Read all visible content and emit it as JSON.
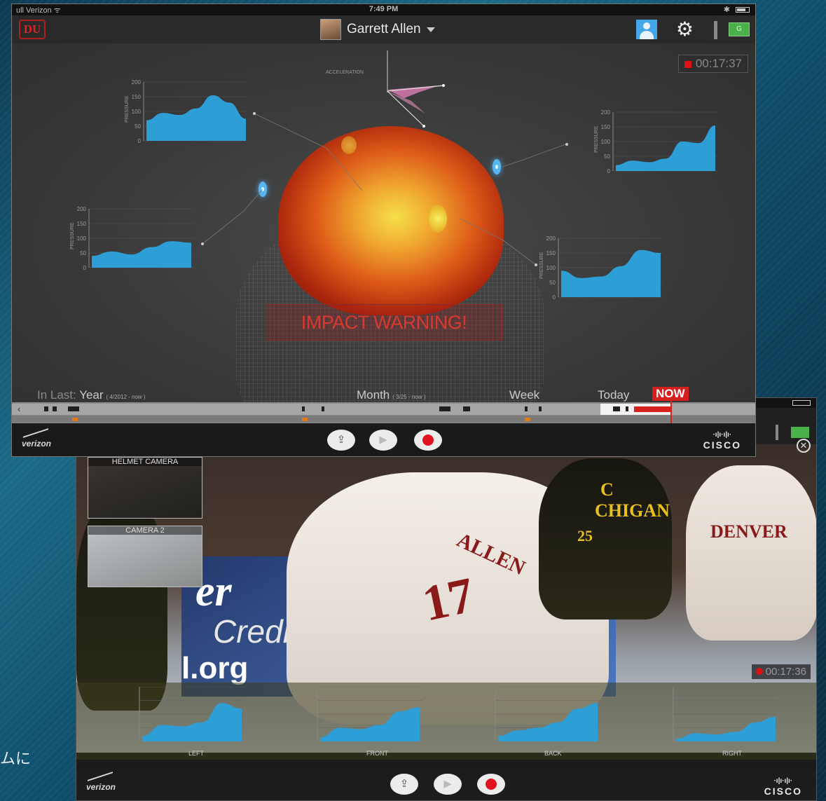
{
  "caption": "ムに",
  "front": {
    "statusbar": {
      "carrier": "ull Verizon ᯤ",
      "time": "7:49 PM",
      "bluetooth": "✱"
    },
    "topbar": {
      "logo": "DU",
      "user_name": "Garrett Allen",
      "green_badge": "G"
    },
    "timer": "00:17:37",
    "accel_label": "ACCELERATION",
    "impact_warning": "IMPACT WARNING!",
    "charts": [
      {
        "id": "top-left",
        "ylabel": "PRESSURE",
        "ticks": [
          "200",
          "150",
          "100",
          "50",
          "0"
        ],
        "values": [
          70,
          95,
          88,
          110,
          155,
          130,
          75
        ]
      },
      {
        "id": "top-right",
        "ylabel": "PRESSURE",
        "ticks": [
          "200",
          "150",
          "100",
          "50",
          "0"
        ],
        "values": [
          20,
          35,
          30,
          42,
          100,
          95,
          155
        ]
      },
      {
        "id": "mid-left",
        "ylabel": "PRESSURE",
        "ticks": [
          "200",
          "150",
          "100",
          "50",
          "0"
        ],
        "values": [
          40,
          55,
          45,
          70,
          90,
          85
        ]
      },
      {
        "id": "mid-right",
        "ylabel": "PRESSURE",
        "ticks": [
          "200",
          "150",
          "100",
          "50",
          "0"
        ],
        "values": [
          90,
          65,
          70,
          105,
          160,
          150
        ]
      }
    ],
    "range": {
      "in_last": "In Last:",
      "year": "Year",
      "year_sub": "( 4/2012 - now )",
      "month": "Month",
      "month_sub": "( 3/25 - now )",
      "week": "Week",
      "today": "Today",
      "now": "NOW"
    },
    "brand_left": "verizon",
    "brand_right_top": "·ı|ı·ı|ı·",
    "brand_right": "CISCO"
  },
  "back": {
    "timer": "00:17:36",
    "thumbs": [
      {
        "label": "HELMET CAMERA"
      },
      {
        "label": "CAMERA 2"
      }
    ],
    "board": {
      "line1": "er",
      "line2": "Credit",
      "line3": "l.org"
    },
    "jerseys": {
      "allen_name": "ALLEN",
      "allen_num": "17",
      "denver": "DENVER",
      "michigan": "CHIGAN",
      "num25": "25",
      "captain": "C"
    },
    "mini_charts": [
      {
        "label": "LEFT",
        "values": [
          20,
          60,
          55,
          70,
          140,
          120
        ]
      },
      {
        "label": "FRONT",
        "values": [
          15,
          50,
          45,
          60,
          110,
          125
        ]
      },
      {
        "label": "BACK",
        "values": [
          20,
          40,
          50,
          70,
          120,
          140
        ]
      },
      {
        "label": "RIGHT",
        "values": [
          10,
          30,
          25,
          35,
          70,
          90
        ]
      }
    ],
    "brand_left": "verizon",
    "brand_right_top": "·ı|ı·ı|ı·",
    "brand_right": "CISCO"
  },
  "colors": {
    "chart_fill": "#2e9fd6",
    "now_red": "#d61f1f",
    "warning": "#d8392e"
  }
}
